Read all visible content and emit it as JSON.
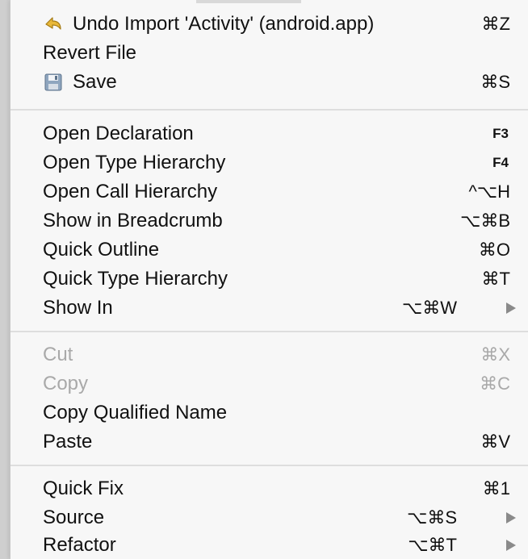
{
  "menu": {
    "items": [
      {
        "label": "Undo Import 'Activity' (android.app)",
        "shortcut": "⌘Z",
        "icon": "undo-arrow-icon"
      },
      {
        "label": "Revert File",
        "shortcut": ""
      },
      {
        "label": "Save",
        "shortcut": "⌘S",
        "icon": "floppy-disk-icon"
      },
      {
        "label": "Open Declaration",
        "shortcut": "F3"
      },
      {
        "label": "Open Type Hierarchy",
        "shortcut": "F4"
      },
      {
        "label": "Open Call Hierarchy",
        "shortcut": "^⌥H"
      },
      {
        "label": "Show in Breadcrumb",
        "shortcut": "⌥⌘B"
      },
      {
        "label": "Quick Outline",
        "shortcut": "⌘O"
      },
      {
        "label": "Quick Type Hierarchy",
        "shortcut": "⌘T"
      },
      {
        "label": "Show In",
        "shortcut": "⌥⌘W",
        "submenu": true
      },
      {
        "label": "Cut",
        "shortcut": "⌘X",
        "disabled": true
      },
      {
        "label": "Copy",
        "shortcut": "⌘C",
        "disabled": true
      },
      {
        "label": "Copy Qualified Name",
        "shortcut": ""
      },
      {
        "label": "Paste",
        "shortcut": "⌘V"
      },
      {
        "label": "Quick Fix",
        "shortcut": "⌘1"
      },
      {
        "label": "Source",
        "shortcut": "⌥⌘S",
        "submenu": true
      },
      {
        "label": "Refactor",
        "shortcut": "⌥⌘T",
        "submenu": true
      }
    ]
  },
  "colors": {
    "menu_background": "#f7f7f7",
    "text": "#111111",
    "disabled_text": "#a9a9a9",
    "separator": "#dedede",
    "undo_icon": "#e8b83a"
  }
}
